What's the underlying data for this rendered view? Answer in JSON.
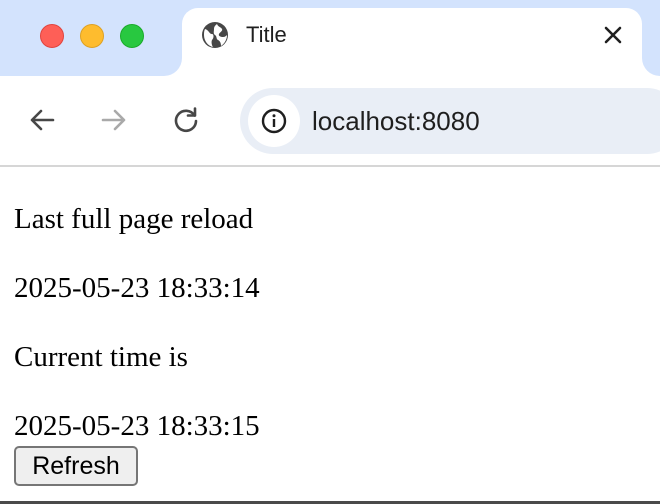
{
  "window": {
    "controls": [
      {
        "name": "close",
        "color": "#fe5f57"
      },
      {
        "name": "minimize",
        "color": "#febc2e"
      },
      {
        "name": "maximize",
        "color": "#28c840"
      }
    ]
  },
  "tab": {
    "icon": "globe-icon",
    "title": "Title",
    "close_icon": "close-icon"
  },
  "toolbar": {
    "back_icon": "arrow-left-icon",
    "forward_icon": "arrow-right-icon",
    "reload_icon": "reload-icon",
    "site_info_icon": "info-icon",
    "url": "localhost:8080"
  },
  "page": {
    "reload_label": "Last full page reload",
    "reload_time": "2025-05-23 18:33:14",
    "current_label": "Current time is",
    "current_time": "2025-05-23 18:33:15",
    "refresh_button": "Refresh"
  },
  "colors": {
    "tab_strip": "#d3e3fd",
    "omnibox": "#e9eef6",
    "text": "#1f1f1f"
  }
}
